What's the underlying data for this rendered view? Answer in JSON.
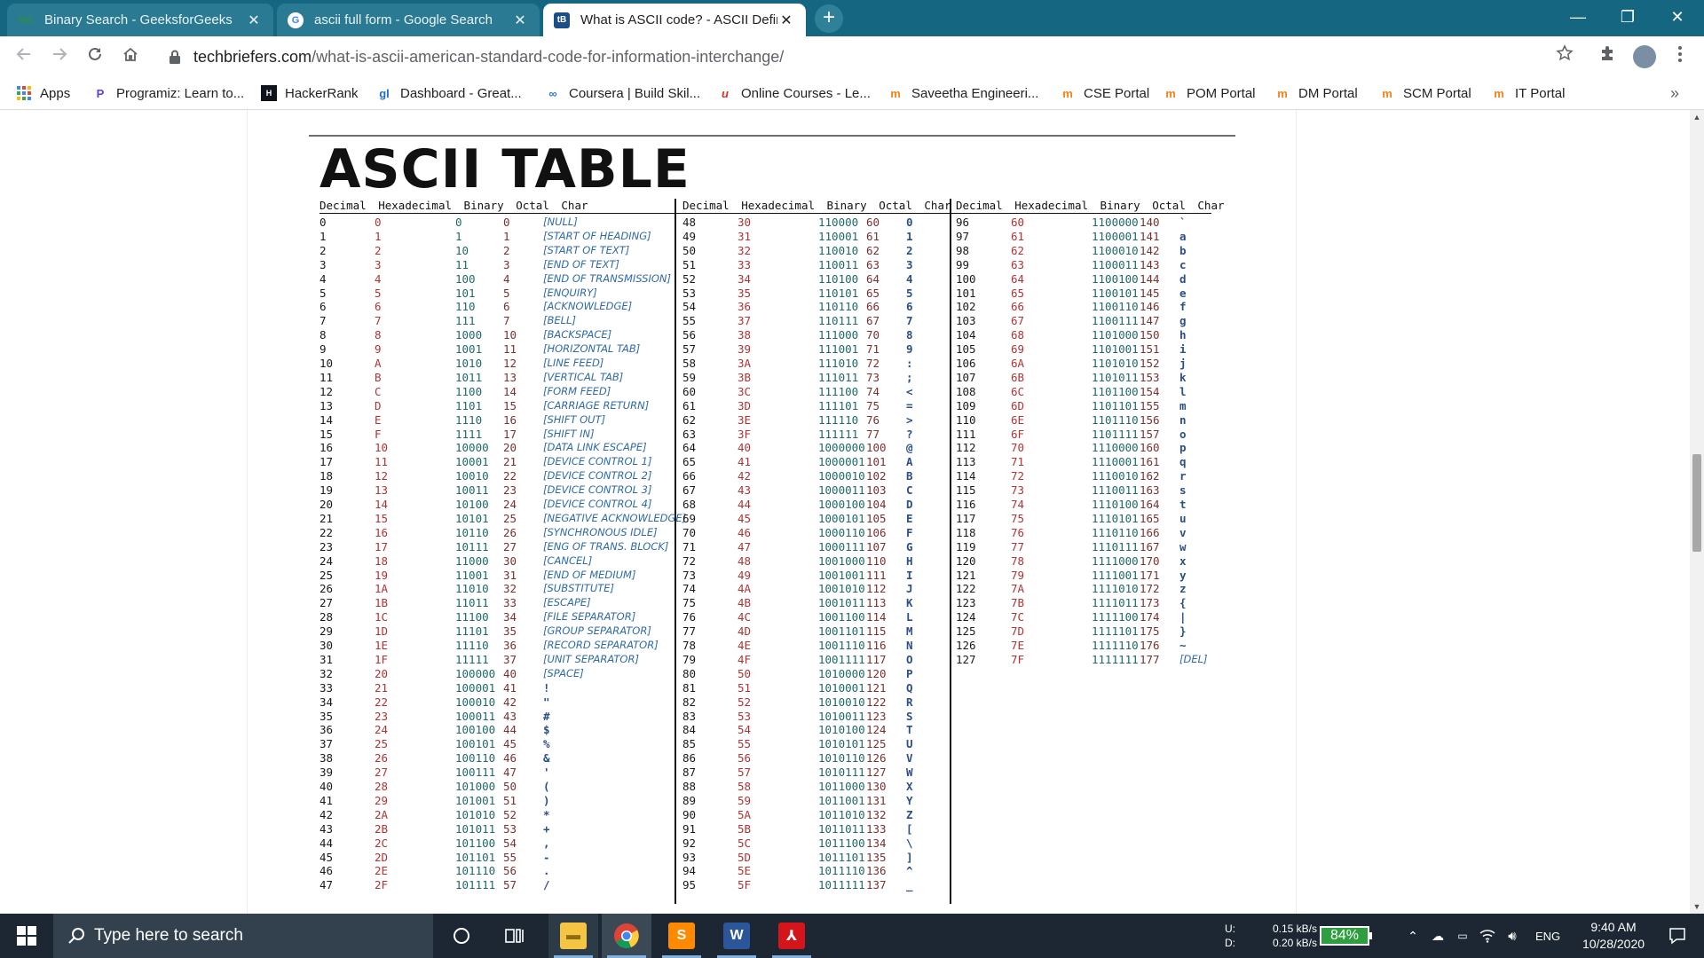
{
  "browser": {
    "tabs": [
      {
        "title": "Binary Search - GeeksforGeeks",
        "icon": "geeksforgeeks-icon",
        "active": false
      },
      {
        "title": "ascii full form - Google Search",
        "icon": "google-icon",
        "active": false
      },
      {
        "title": "What is ASCII code? - ASCII Defin",
        "icon": "techbriefers-icon",
        "active": true
      }
    ],
    "tab_close": "✕",
    "new_tab": "+",
    "window_controls": {
      "minimize": "—",
      "maximize": "❐",
      "close": "✕"
    },
    "url_host": "techbriefers.com",
    "url_path": "/what-is-ascii-american-standard-code-for-information-interchange/",
    "bookmarks": [
      {
        "label": "Apps",
        "icon": "apps-grid-icon",
        "color": "#4285f4"
      },
      {
        "label": "Programiz: Learn to...",
        "icon": "programiz-icon",
        "color": "#5b3ee6"
      },
      {
        "label": "HackerRank",
        "icon": "hackerrank-icon",
        "color": "#0e141e"
      },
      {
        "label": "Dashboard - Great...",
        "icon": "greatlearning-icon",
        "color": "#1f6fd0"
      },
      {
        "label": "Coursera | Build Skil...",
        "icon": "coursera-icon",
        "color": "#2a73cc"
      },
      {
        "label": "Online Courses - Le...",
        "icon": "udemy-icon",
        "color": "#d93025"
      },
      {
        "label": "Saveetha Engineeri...",
        "icon": "moodle-icon",
        "color": "#f98012"
      },
      {
        "label": "CSE Portal",
        "icon": "moodle-icon",
        "color": "#f98012"
      },
      {
        "label": "POM Portal",
        "icon": "moodle-icon",
        "color": "#f98012"
      },
      {
        "label": "DM Portal",
        "icon": "moodle-icon",
        "color": "#f98012"
      },
      {
        "label": "SCM Portal",
        "icon": "moodle-icon",
        "color": "#f98012"
      },
      {
        "label": "IT Portal",
        "icon": "moodle-icon",
        "color": "#f98012"
      }
    ],
    "bookmarks_overflow": "»"
  },
  "page": {
    "title": "ASCII TABLE",
    "column_headers": {
      "decimal": "Decimal",
      "hex": "Hexadecimal",
      "binary": "Binary",
      "octal": "Octal",
      "char": "Char"
    },
    "colors": {
      "decimal": "#1a1a1a",
      "hex": "#b03333",
      "binary": "#1f6868",
      "octal": "#7a3030",
      "char": "#2f6aa8"
    },
    "ascii_rows": [
      [
        "0",
        "0",
        "0",
        "0",
        "[NULL]"
      ],
      [
        "1",
        "1",
        "1",
        "1",
        "[START OF HEADING]"
      ],
      [
        "2",
        "2",
        "10",
        "2",
        "[START OF TEXT]"
      ],
      [
        "3",
        "3",
        "11",
        "3",
        "[END OF TEXT]"
      ],
      [
        "4",
        "4",
        "100",
        "4",
        "[END OF TRANSMISSION]"
      ],
      [
        "5",
        "5",
        "101",
        "5",
        "[ENQUIRY]"
      ],
      [
        "6",
        "6",
        "110",
        "6",
        "[ACKNOWLEDGE]"
      ],
      [
        "7",
        "7",
        "111",
        "7",
        "[BELL]"
      ],
      [
        "8",
        "8",
        "1000",
        "10",
        "[BACKSPACE]"
      ],
      [
        "9",
        "9",
        "1001",
        "11",
        "[HORIZONTAL TAB]"
      ],
      [
        "10",
        "A",
        "1010",
        "12",
        "[LINE FEED]"
      ],
      [
        "11",
        "B",
        "1011",
        "13",
        "[VERTICAL TAB]"
      ],
      [
        "12",
        "C",
        "1100",
        "14",
        "[FORM FEED]"
      ],
      [
        "13",
        "D",
        "1101",
        "15",
        "[CARRIAGE RETURN]"
      ],
      [
        "14",
        "E",
        "1110",
        "16",
        "[SHIFT OUT]"
      ],
      [
        "15",
        "F",
        "1111",
        "17",
        "[SHIFT IN]"
      ],
      [
        "16",
        "10",
        "10000",
        "20",
        "[DATA LINK ESCAPE]"
      ],
      [
        "17",
        "11",
        "10001",
        "21",
        "[DEVICE CONTROL 1]"
      ],
      [
        "18",
        "12",
        "10010",
        "22",
        "[DEVICE CONTROL 2]"
      ],
      [
        "19",
        "13",
        "10011",
        "23",
        "[DEVICE CONTROL 3]"
      ],
      [
        "20",
        "14",
        "10100",
        "24",
        "[DEVICE CONTROL 4]"
      ],
      [
        "21",
        "15",
        "10101",
        "25",
        "[NEGATIVE ACKNOWLEDGE]"
      ],
      [
        "22",
        "16",
        "10110",
        "26",
        "[SYNCHRONOUS IDLE]"
      ],
      [
        "23",
        "17",
        "10111",
        "27",
        "[ENG OF TRANS. BLOCK]"
      ],
      [
        "24",
        "18",
        "11000",
        "30",
        "[CANCEL]"
      ],
      [
        "25",
        "19",
        "11001",
        "31",
        "[END OF MEDIUM]"
      ],
      [
        "26",
        "1A",
        "11010",
        "32",
        "[SUBSTITUTE]"
      ],
      [
        "27",
        "1B",
        "11011",
        "33",
        "[ESCAPE]"
      ],
      [
        "28",
        "1C",
        "11100",
        "34",
        "[FILE SEPARATOR]"
      ],
      [
        "29",
        "1D",
        "11101",
        "35",
        "[GROUP SEPARATOR]"
      ],
      [
        "30",
        "1E",
        "11110",
        "36",
        "[RECORD SEPARATOR]"
      ],
      [
        "31",
        "1F",
        "11111",
        "37",
        "[UNIT SEPARATOR]"
      ],
      [
        "32",
        "20",
        "100000",
        "40",
        "[SPACE]"
      ],
      [
        "33",
        "21",
        "100001",
        "41",
        "!"
      ],
      [
        "34",
        "22",
        "100010",
        "42",
        "\""
      ],
      [
        "35",
        "23",
        "100011",
        "43",
        "#"
      ],
      [
        "36",
        "24",
        "100100",
        "44",
        "$"
      ],
      [
        "37",
        "25",
        "100101",
        "45",
        "%"
      ],
      [
        "38",
        "26",
        "100110",
        "46",
        "&"
      ],
      [
        "39",
        "27",
        "100111",
        "47",
        "'"
      ],
      [
        "40",
        "28",
        "101000",
        "50",
        "("
      ],
      [
        "41",
        "29",
        "101001",
        "51",
        ")"
      ],
      [
        "42",
        "2A",
        "101010",
        "52",
        "*"
      ],
      [
        "43",
        "2B",
        "101011",
        "53",
        "+"
      ],
      [
        "44",
        "2C",
        "101100",
        "54",
        ","
      ],
      [
        "45",
        "2D",
        "101101",
        "55",
        "-"
      ],
      [
        "46",
        "2E",
        "101110",
        "56",
        "."
      ],
      [
        "47",
        "2F",
        "101111",
        "57",
        "/"
      ],
      [
        "48",
        "30",
        "110000",
        "60",
        "0"
      ],
      [
        "49",
        "31",
        "110001",
        "61",
        "1"
      ],
      [
        "50",
        "32",
        "110010",
        "62",
        "2"
      ],
      [
        "51",
        "33",
        "110011",
        "63",
        "3"
      ],
      [
        "52",
        "34",
        "110100",
        "64",
        "4"
      ],
      [
        "53",
        "35",
        "110101",
        "65",
        "5"
      ],
      [
        "54",
        "36",
        "110110",
        "66",
        "6"
      ],
      [
        "55",
        "37",
        "110111",
        "67",
        "7"
      ],
      [
        "56",
        "38",
        "111000",
        "70",
        "8"
      ],
      [
        "57",
        "39",
        "111001",
        "71",
        "9"
      ],
      [
        "58",
        "3A",
        "111010",
        "72",
        ":"
      ],
      [
        "59",
        "3B",
        "111011",
        "73",
        ";"
      ],
      [
        "60",
        "3C",
        "111100",
        "74",
        "<"
      ],
      [
        "61",
        "3D",
        "111101",
        "75",
        "="
      ],
      [
        "62",
        "3E",
        "111110",
        "76",
        ">"
      ],
      [
        "63",
        "3F",
        "111111",
        "77",
        "?"
      ],
      [
        "64",
        "40",
        "1000000",
        "100",
        "@"
      ],
      [
        "65",
        "41",
        "1000001",
        "101",
        "A"
      ],
      [
        "66",
        "42",
        "1000010",
        "102",
        "B"
      ],
      [
        "67",
        "43",
        "1000011",
        "103",
        "C"
      ],
      [
        "68",
        "44",
        "1000100",
        "104",
        "D"
      ],
      [
        "69",
        "45",
        "1000101",
        "105",
        "E"
      ],
      [
        "70",
        "46",
        "1000110",
        "106",
        "F"
      ],
      [
        "71",
        "47",
        "1000111",
        "107",
        "G"
      ],
      [
        "72",
        "48",
        "1001000",
        "110",
        "H"
      ],
      [
        "73",
        "49",
        "1001001",
        "111",
        "I"
      ],
      [
        "74",
        "4A",
        "1001010",
        "112",
        "J"
      ],
      [
        "75",
        "4B",
        "1001011",
        "113",
        "K"
      ],
      [
        "76",
        "4C",
        "1001100",
        "114",
        "L"
      ],
      [
        "77",
        "4D",
        "1001101",
        "115",
        "M"
      ],
      [
        "78",
        "4E",
        "1001110",
        "116",
        "N"
      ],
      [
        "79",
        "4F",
        "1001111",
        "117",
        "O"
      ],
      [
        "80",
        "50",
        "1010000",
        "120",
        "P"
      ],
      [
        "81",
        "51",
        "1010001",
        "121",
        "Q"
      ],
      [
        "82",
        "52",
        "1010010",
        "122",
        "R"
      ],
      [
        "83",
        "53",
        "1010011",
        "123",
        "S"
      ],
      [
        "84",
        "54",
        "1010100",
        "124",
        "T"
      ],
      [
        "85",
        "55",
        "1010101",
        "125",
        "U"
      ],
      [
        "86",
        "56",
        "1010110",
        "126",
        "V"
      ],
      [
        "87",
        "57",
        "1010111",
        "127",
        "W"
      ],
      [
        "88",
        "58",
        "1011000",
        "130",
        "X"
      ],
      [
        "89",
        "59",
        "1011001",
        "131",
        "Y"
      ],
      [
        "90",
        "5A",
        "1011010",
        "132",
        "Z"
      ],
      [
        "91",
        "5B",
        "1011011",
        "133",
        "["
      ],
      [
        "92",
        "5C",
        "1011100",
        "134",
        "\\"
      ],
      [
        "93",
        "5D",
        "1011101",
        "135",
        "]"
      ],
      [
        "94",
        "5E",
        "1011110",
        "136",
        "^"
      ],
      [
        "95",
        "5F",
        "1011111",
        "137",
        "_"
      ],
      [
        "96",
        "60",
        "1100000",
        "140",
        "`"
      ],
      [
        "97",
        "61",
        "1100001",
        "141",
        "a"
      ],
      [
        "98",
        "62",
        "1100010",
        "142",
        "b"
      ],
      [
        "99",
        "63",
        "1100011",
        "143",
        "c"
      ],
      [
        "100",
        "64",
        "1100100",
        "144",
        "d"
      ],
      [
        "101",
        "65",
        "1100101",
        "145",
        "e"
      ],
      [
        "102",
        "66",
        "1100110",
        "146",
        "f"
      ],
      [
        "103",
        "67",
        "1100111",
        "147",
        "g"
      ],
      [
        "104",
        "68",
        "1101000",
        "150",
        "h"
      ],
      [
        "105",
        "69",
        "1101001",
        "151",
        "i"
      ],
      [
        "106",
        "6A",
        "1101010",
        "152",
        "j"
      ],
      [
        "107",
        "6B",
        "1101011",
        "153",
        "k"
      ],
      [
        "108",
        "6C",
        "1101100",
        "154",
        "l"
      ],
      [
        "109",
        "6D",
        "1101101",
        "155",
        "m"
      ],
      [
        "110",
        "6E",
        "1101110",
        "156",
        "n"
      ],
      [
        "111",
        "6F",
        "1101111",
        "157",
        "o"
      ],
      [
        "112",
        "70",
        "1110000",
        "160",
        "p"
      ],
      [
        "113",
        "71",
        "1110001",
        "161",
        "q"
      ],
      [
        "114",
        "72",
        "1110010",
        "162",
        "r"
      ],
      [
        "115",
        "73",
        "1110011",
        "163",
        "s"
      ],
      [
        "116",
        "74",
        "1110100",
        "164",
        "t"
      ],
      [
        "117",
        "75",
        "1110101",
        "165",
        "u"
      ],
      [
        "118",
        "76",
        "1110110",
        "166",
        "v"
      ],
      [
        "119",
        "77",
        "1110111",
        "167",
        "w"
      ],
      [
        "120",
        "78",
        "1111000",
        "170",
        "x"
      ],
      [
        "121",
        "79",
        "1111001",
        "171",
        "y"
      ],
      [
        "122",
        "7A",
        "1111010",
        "172",
        "z"
      ],
      [
        "123",
        "7B",
        "1111011",
        "173",
        "{"
      ],
      [
        "124",
        "7C",
        "1111100",
        "174",
        "|"
      ],
      [
        "125",
        "7D",
        "1111101",
        "175",
        "}"
      ],
      [
        "126",
        "7E",
        "1111110",
        "176",
        "~"
      ],
      [
        "127",
        "7F",
        "1111111",
        "177",
        "[DEL]"
      ]
    ]
  },
  "taskbar": {
    "search_placeholder": "Type here to search",
    "apps": [
      {
        "name": "task-view",
        "icon": "task-view-icon"
      },
      {
        "name": "file-explorer",
        "icon": "folder-icon"
      },
      {
        "name": "chrome",
        "icon": "chrome-icon"
      },
      {
        "name": "sublime-text",
        "icon": "sublime-icon"
      },
      {
        "name": "word",
        "icon": "word-icon"
      },
      {
        "name": "acrobat",
        "icon": "acrobat-icon"
      }
    ],
    "net_up_label": "U:",
    "net_down_label": "D:",
    "net_up": "0.15 kB/s",
    "net_down": "0.20 kB/s",
    "battery": "84%",
    "language": "ENG",
    "time": "9:40 AM",
    "date": "10/28/2020"
  }
}
